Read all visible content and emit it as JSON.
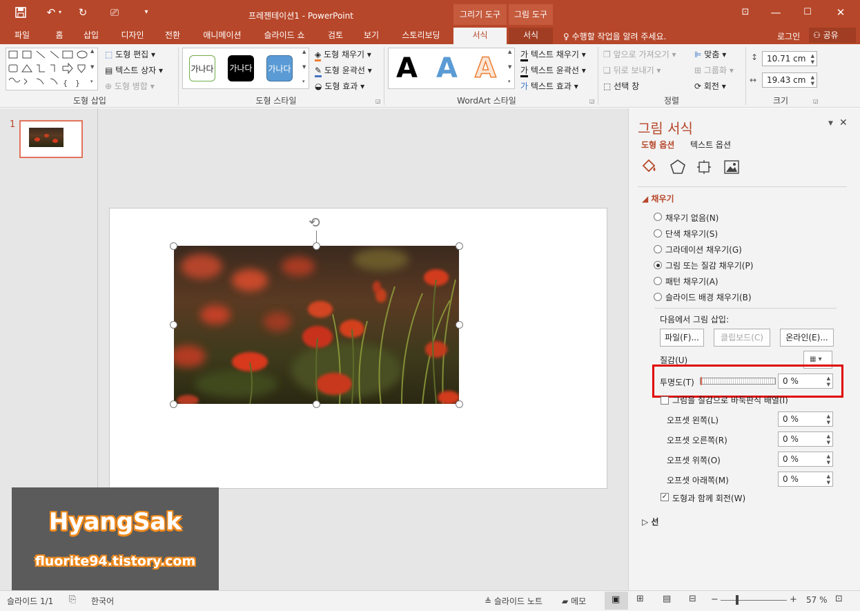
{
  "title": {
    "doc": "프레젠테이션1",
    "sep": " - ",
    "app": "PowerPoint"
  },
  "context_tabs": {
    "drawing_tools": "그리기 도구",
    "picture_tools": "그림 도구"
  },
  "tabs": [
    "파일",
    "홈",
    "삽입",
    "디자인",
    "전환",
    "애니메이션",
    "슬라이드 쇼",
    "검토",
    "보기",
    "스토리보딩",
    "서식",
    "서식"
  ],
  "tell_me": "수행할 작업을 알려 주세요.",
  "login": "로그인",
  "share": "공유",
  "ribbon": {
    "insert_shapes": {
      "label": "도형 삽입",
      "edit_shape": "도형 편집",
      "text_box": "텍스트 상자",
      "merge_shapes": "도형 병합"
    },
    "shape_styles": {
      "label": "도형 스타일",
      "swatch_text": "가나다",
      "fill": "도형 채우기",
      "outline": "도형 윤곽선",
      "effects": "도형 효과"
    },
    "wordart": {
      "label": "WordArt 스타일",
      "letter": "A",
      "text_fill": "텍스트 채우기",
      "text_outline": "텍스트 윤곽선",
      "text_effects": "텍스트 효과"
    },
    "arrange": {
      "label": "정렬",
      "bring_forward": "앞으로 가져오기",
      "send_backward": "뒤로 보내기",
      "selection_pane": "선택 창",
      "align": "맞춤",
      "group": "그룹화",
      "rotate": "회전"
    },
    "size": {
      "label": "크기",
      "height": "10.71 cm",
      "width": "19.43 cm"
    }
  },
  "thumb_number": "1",
  "pane": {
    "title": "그림 서식",
    "tab_shape": "도형 옵션",
    "tab_text": "텍스트 옵션",
    "section_fill": "채우기",
    "fill_options": [
      "채우기 없음(N)",
      "단색 채우기(S)",
      "그라데이션 채우기(G)",
      "그림 또는 질감 채우기(P)",
      "패턴 채우기(A)",
      "슬라이드 배경 채우기(B)"
    ],
    "insert_from": "다음에서 그림 삽입:",
    "btn_file": "파일(F)...",
    "btn_clipboard": "클립보드(C)",
    "btn_online": "온라인(E)...",
    "texture": "질감(U)",
    "transparency": "투명도(T)",
    "transparency_value": "0 %",
    "tile": "그림을 질감으로 바둑판식 배열(I)",
    "offsets": [
      {
        "label": "오프셋 왼쪽(L)",
        "value": "0 %"
      },
      {
        "label": "오프셋 오른쪽(R)",
        "value": "0 %"
      },
      {
        "label": "오프셋 위쪽(O)",
        "value": "0 %"
      },
      {
        "label": "오프셋 아래쪽(M)",
        "value": "0 %"
      }
    ],
    "rotate_with_shape": "도형과 함께 회전(W)",
    "section_line": "선"
  },
  "status": {
    "slide": "슬라이드 1/1",
    "lang": "한국어",
    "notes": "슬라이드 노트",
    "comments": "메모",
    "zoom": "57 %"
  },
  "watermark": {
    "name": "HyangSak",
    "url": "fluorite94.tistory.com"
  },
  "colors": {
    "accent": "#b7472a",
    "highlight": "#e00000"
  }
}
